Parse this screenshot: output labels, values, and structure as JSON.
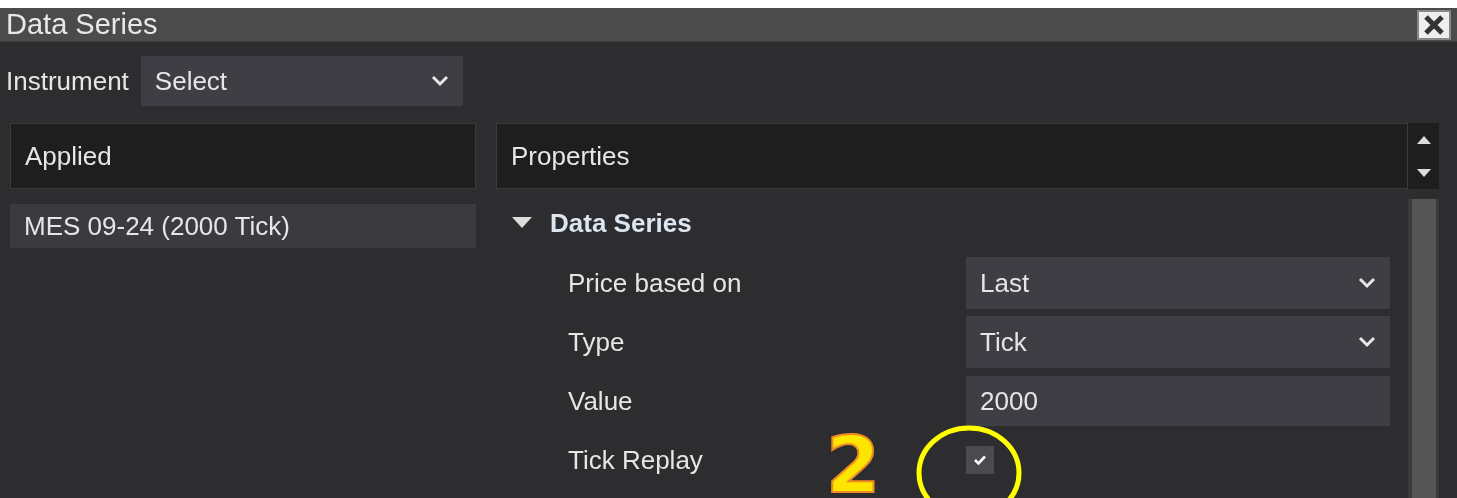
{
  "window": {
    "title": "Data Series"
  },
  "instrument": {
    "label": "Instrument",
    "value": "Select"
  },
  "applied": {
    "header": "Applied",
    "items": [
      {
        "label": "MES 09-24 (2000 Tick)",
        "selected": true
      }
    ]
  },
  "properties": {
    "header": "Properties",
    "group": {
      "title": "Data Series",
      "expanded": true,
      "rows": [
        {
          "kind": "dropdown",
          "label": "Price based on",
          "value": "Last"
        },
        {
          "kind": "dropdown",
          "label": "Type",
          "value": "Tick"
        },
        {
          "kind": "text",
          "label": "Value",
          "value": "2000"
        },
        {
          "kind": "checkbox",
          "label": "Tick Replay",
          "checked": true
        }
      ]
    }
  },
  "annotation": {
    "label": "2"
  }
}
